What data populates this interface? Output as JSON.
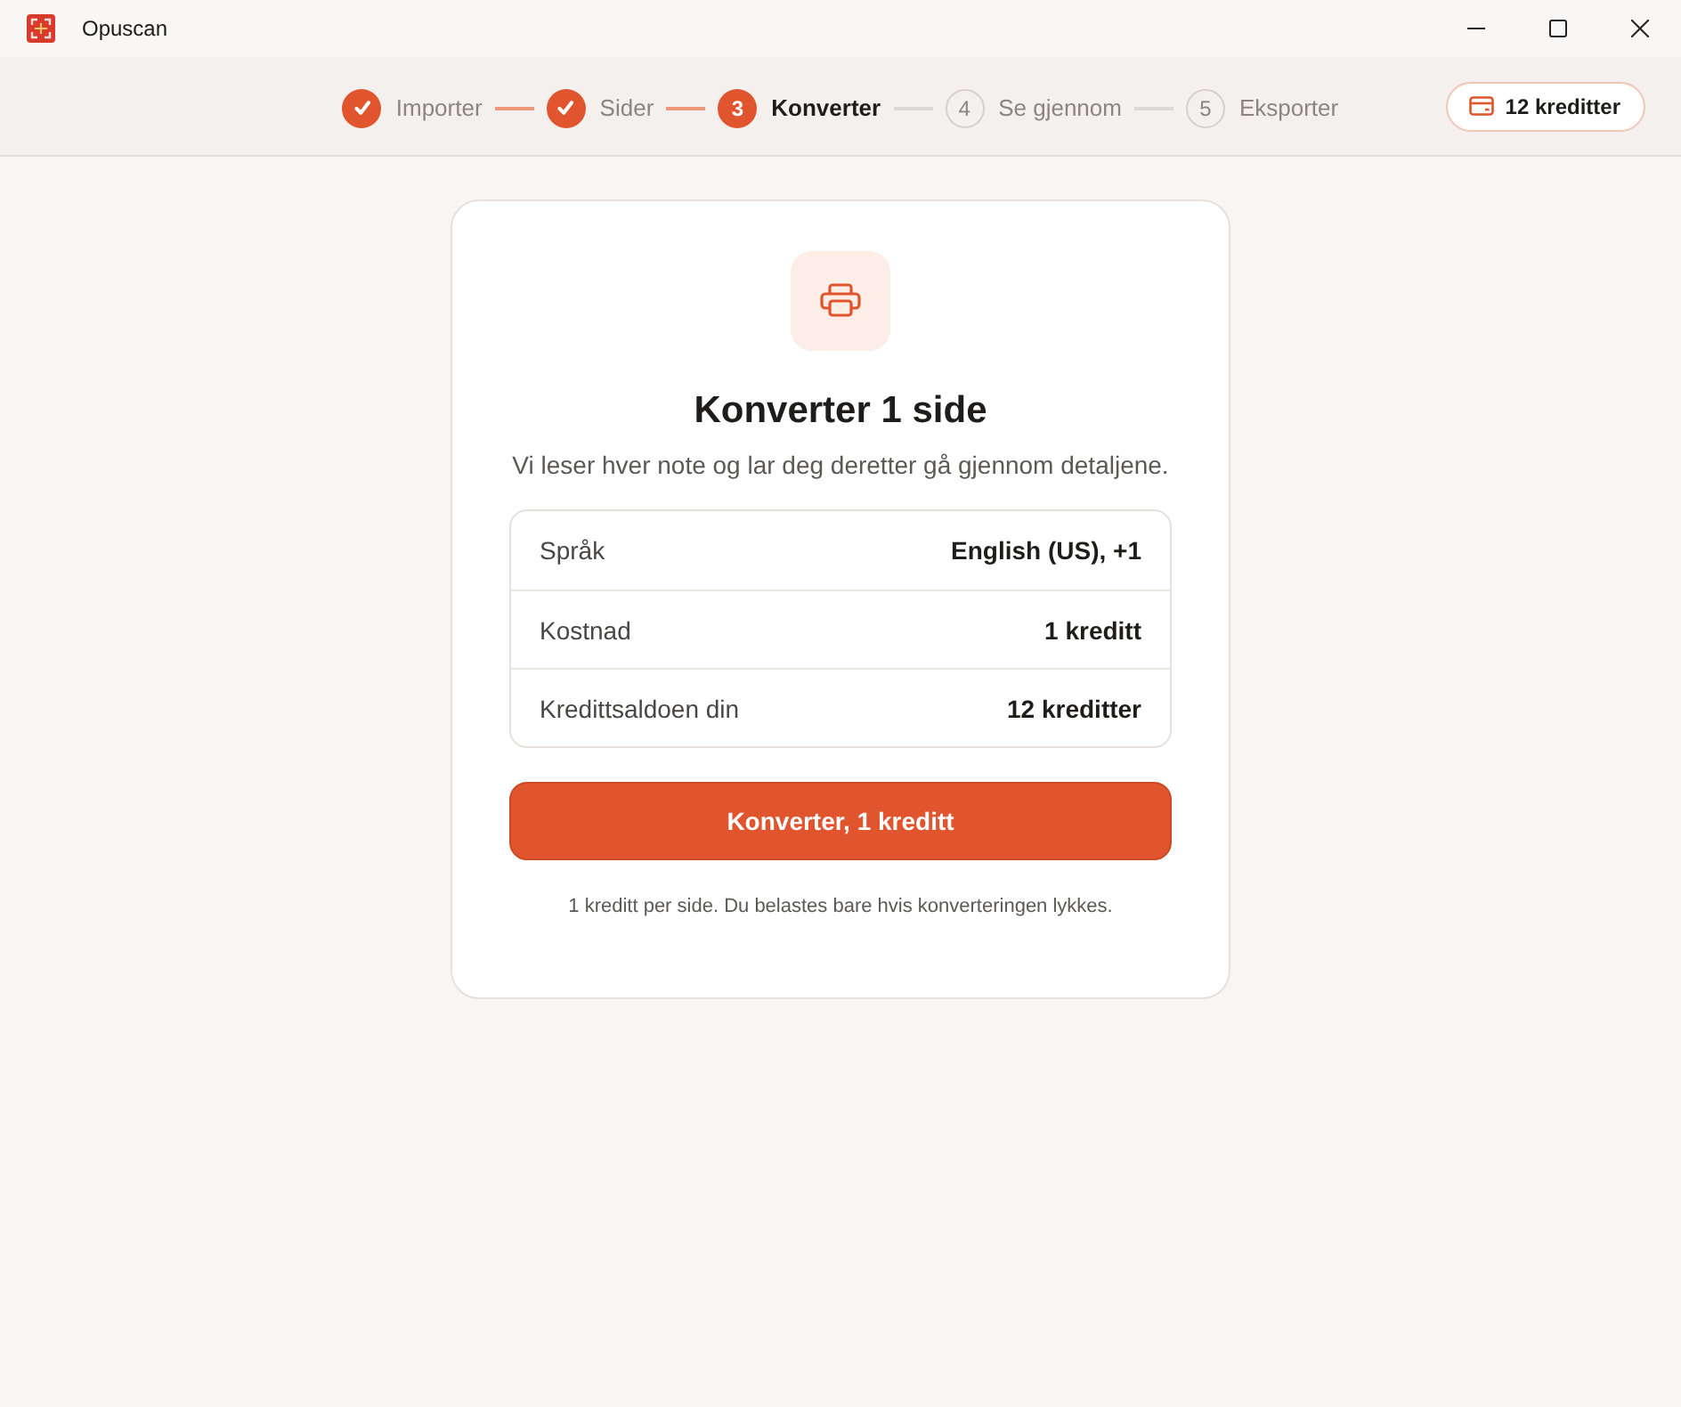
{
  "window": {
    "title": "Opuscan"
  },
  "stepper": {
    "steps": [
      {
        "label": "Importer",
        "completed": true,
        "selected": false
      },
      {
        "label": "Sider",
        "completed": true,
        "selected": false
      },
      {
        "label": "Konverter",
        "number": "3",
        "completed": false,
        "selected": true
      },
      {
        "label": "Se gjennom",
        "number": "4",
        "completed": false,
        "selected": false
      },
      {
        "label": "Eksporter",
        "number": "5",
        "completed": false,
        "selected": false
      }
    ]
  },
  "credits_button": {
    "label": "12 kreditter"
  },
  "card": {
    "title": "Konverter 1 side",
    "subtitle": "Vi leser hver note og lar deg deretter gå gjennom detaljene.",
    "details": [
      {
        "label": "Språk",
        "value": "English (US), +1"
      },
      {
        "label": "Kostnad",
        "value": "1 kreditt"
      },
      {
        "label": "Kredittsaldoen din",
        "value": "12 kreditter"
      }
    ],
    "primary_button": {
      "label": "Konverter, 1 kreditt"
    },
    "footnote": "1 kreditt per side. Du belastes bare hvis konverteringen lykkes."
  }
}
